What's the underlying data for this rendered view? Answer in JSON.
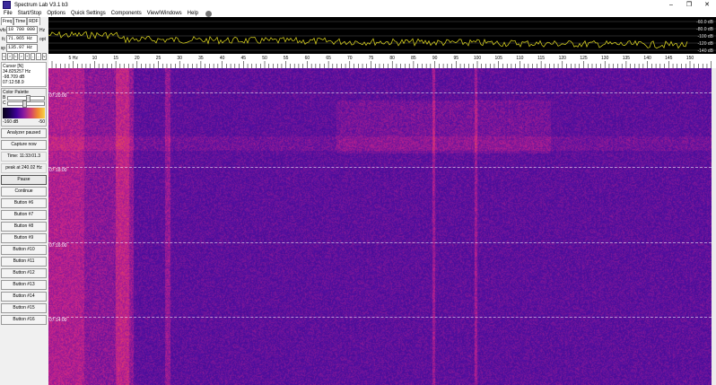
{
  "window": {
    "title": "Spectrum Lab V3.1 b3"
  },
  "window_controls": {
    "minimize": "–",
    "maximize": "❐",
    "close": "✕"
  },
  "menu": [
    "File",
    "Start/Stop",
    "Options",
    "Quick Settings",
    "Components",
    "View/Windows",
    "Help"
  ],
  "tabs": [
    "Freq",
    "Time",
    "RDF"
  ],
  "freq": {
    "vfo_label": "vfo",
    "vfo_value": "10 700 000",
    "vfo_unit": "Hz",
    "fc_label": "fc",
    "fc_value": "71.965 Hz",
    "fc_unit": "opt",
    "sp_label": "sp",
    "sp_value": "135.97 Hz",
    "sp_unit": ""
  },
  "nav_buttons": [
    "<",
    ">",
    "<",
    ">",
    "+",
    "-",
    "-",
    "v"
  ],
  "cursor": {
    "heading": "Cursor [N]",
    "freq": "34.825257 Hz",
    "level": "-98.709 dB",
    "time": "07:12:58.9"
  },
  "palette": {
    "heading": "Color Palette",
    "b_label": "B",
    "c_label": "C",
    "b_value": 0.5,
    "c_value": 0.4,
    "min_label": "-160 dB",
    "max_label": "-50"
  },
  "buttons": {
    "analyzer": "Analyzer paused",
    "capture": "Capture now",
    "time": "Time:   11:33:01.3",
    "peak": "peak at 240.02 Hz",
    "pause": "Pause",
    "continue": "Continue",
    "b6": "Button #6",
    "b7": "Button #7",
    "b8": "Button #8",
    "b9": "Button #9",
    "b10": "Button #10",
    "b11": "Button #11",
    "b12": "Button #12",
    "b13": "Button #13",
    "b14": "Button #14",
    "b15": "Button #15",
    "b16": "Button #16"
  },
  "spectrum": {
    "db_labels": [
      "-60.0 dB",
      "-80.0 dB",
      "-100 dB",
      "-120 dB",
      "-140 dB"
    ],
    "trace_color": "#e8e020"
  },
  "freq_axis": {
    "labels": [
      "5 Hz",
      "10",
      "15",
      "20",
      "25",
      "30",
      "35",
      "40",
      "45",
      "50",
      "55",
      "60",
      "65",
      "70",
      "75",
      "80",
      "85",
      "90",
      "95",
      "100",
      "105",
      "110",
      "115",
      "120",
      "125",
      "130",
      "135",
      "140",
      "145",
      "150"
    ]
  },
  "waterfall": {
    "timestamps": [
      "07:20:00",
      "07:18:00",
      "07:16:00",
      "07:14:00"
    ]
  }
}
